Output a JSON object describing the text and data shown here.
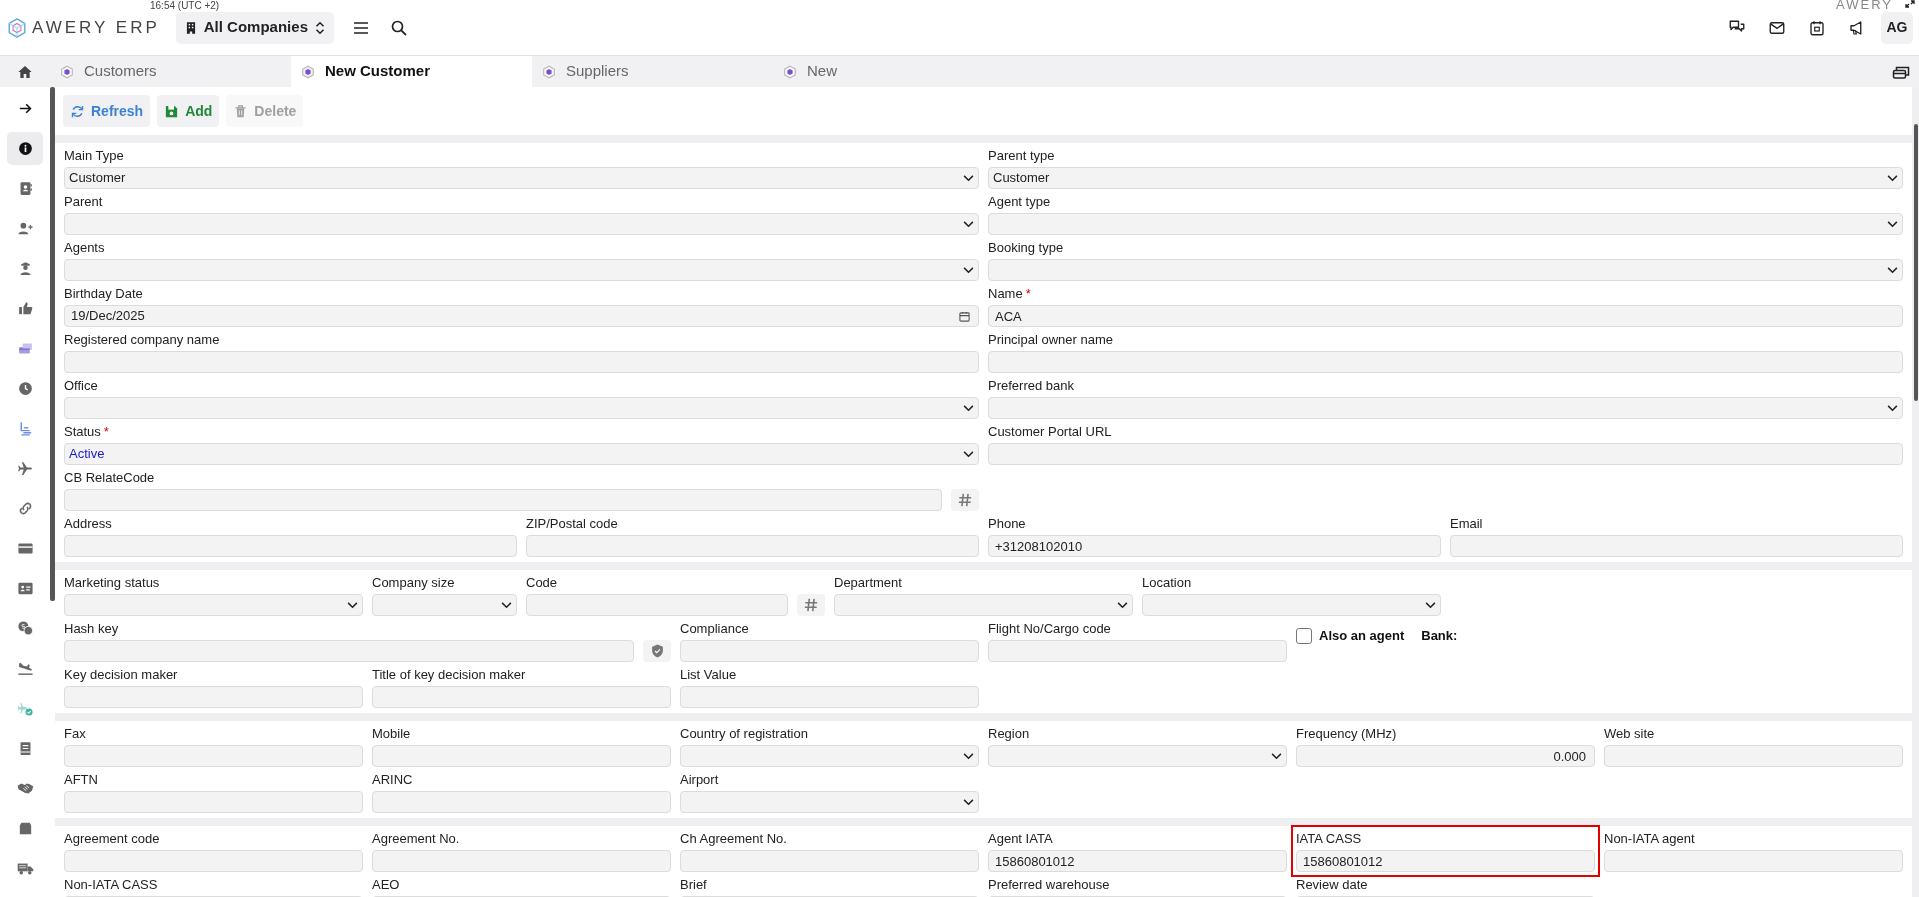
{
  "header": {
    "time": "16:54 (UTC +2)",
    "logo": "AWERY ERP",
    "company": "All Companies",
    "avatar": "AG",
    "corner_logo": "AWERY"
  },
  "tabs": [
    {
      "label": "Customers",
      "selected": false
    },
    {
      "label": "New Customer",
      "selected": true
    },
    {
      "label": "Suppliers",
      "selected": false
    },
    {
      "label": "New",
      "selected": false
    }
  ],
  "sidebar": [
    {
      "kind": "arrow",
      "selected": false
    },
    {
      "kind": "info",
      "selected": true
    },
    {
      "kind": "contact",
      "selected": false
    },
    {
      "kind": "user-plus",
      "selected": false
    },
    {
      "kind": "officer",
      "selected": false
    },
    {
      "kind": "thumb",
      "selected": false
    },
    {
      "kind": "cards",
      "selected": false
    },
    {
      "kind": "clock",
      "selected": false
    },
    {
      "kind": "seat",
      "selected": false
    },
    {
      "kind": "plane",
      "selected": false
    },
    {
      "kind": "link",
      "selected": false
    },
    {
      "kind": "card",
      "selected": false
    },
    {
      "kind": "id",
      "selected": false
    },
    {
      "kind": "chat",
      "selected": false
    },
    {
      "kind": "landing",
      "selected": false
    },
    {
      "kind": "plane-check",
      "selected": false
    },
    {
      "kind": "book",
      "selected": false
    },
    {
      "kind": "handshake",
      "selected": false
    },
    {
      "kind": "box",
      "selected": false
    },
    {
      "kind": "truck",
      "selected": false
    }
  ],
  "toolbar": [
    {
      "kind": "refresh",
      "label": "Refresh",
      "disabled": false
    },
    {
      "kind": "add",
      "label": "Add",
      "disabled": false
    },
    {
      "kind": "delete",
      "label": "Delete",
      "disabled": true
    }
  ],
  "sections": [
    {
      "rows": [
        [
          {
            "label": "Main Type",
            "kind": "select",
            "value": "Customer"
          },
          {
            "label": "Parent type",
            "kind": "select",
            "value": "Customer"
          }
        ],
        [
          {
            "label": "Parent",
            "kind": "select"
          },
          {
            "label": "Agent type",
            "kind": "select"
          }
        ],
        [
          {
            "label": "Agents",
            "kind": "select"
          },
          {
            "label": "Booking type",
            "kind": "select"
          }
        ],
        [
          {
            "label": "Birthday Date",
            "kind": "date",
            "value": "19/Dec/2025"
          },
          {
            "label": "Name",
            "required_mark": "*",
            "kind": "input",
            "value": "ACA"
          }
        ],
        [
          {
            "label": "Registered company name",
            "kind": "input"
          },
          {
            "label": "Principal owner name",
            "kind": "input"
          }
        ],
        [
          {
            "label": "Office",
            "kind": "select"
          },
          {
            "label": "Preferred bank",
            "kind": "select"
          }
        ],
        [
          {
            "label": "Status",
            "required_mark": "*",
            "kind": "select",
            "value": "Active",
            "color": "#1a1acc"
          },
          {
            "label": "Customer Portal URL",
            "kind": "input"
          }
        ],
        [
          {
            "label": "CB RelateCode",
            "kind": "input_hash"
          }
        ],
        [
          {
            "label": "Address",
            "kind": "input"
          },
          {
            "label": "ZIP/Postal code",
            "kind": "input"
          },
          {
            "label": "Phone",
            "kind": "input",
            "value": "+31208102010"
          },
          {
            "label": "Email",
            "kind": "input"
          }
        ]
      ]
    },
    {
      "rows": [
        [
          {
            "label": "Marketing status",
            "kind": "select"
          },
          {
            "label": "Company size",
            "kind": "select"
          },
          {
            "label": "Code",
            "kind": "input_hash"
          },
          {
            "label": "Department",
            "kind": "select"
          },
          {
            "label": "Location",
            "kind": "select"
          }
        ],
        [
          {
            "label": "Hash key",
            "kind": "input_shield"
          },
          {
            "label": "Compliance",
            "kind": "input"
          },
          {
            "label": "Flight No/Cargo code",
            "kind": "input"
          },
          {
            "label": "Also an agent",
            "kind": "checkbox",
            "checked": false,
            "note": "Bank:"
          }
        ],
        [
          {
            "label": "Key decision maker",
            "kind": "input"
          },
          {
            "label": "Title of key decision maker",
            "kind": "input"
          },
          {
            "label": "List Value",
            "kind": "input"
          }
        ]
      ]
    },
    {
      "rows": [
        [
          {
            "label": "Fax",
            "kind": "input"
          },
          {
            "label": "Mobile",
            "kind": "input"
          },
          {
            "label": "Country of registration",
            "kind": "select"
          },
          {
            "label": "Region",
            "kind": "select"
          },
          {
            "label": "Frequency (MHz)",
            "kind": "number",
            "value": "0.000"
          },
          {
            "label": "Web site",
            "kind": "input"
          }
        ],
        [
          {
            "label": "AFTN",
            "kind": "input"
          },
          {
            "label": "ARINC",
            "kind": "input"
          },
          {
            "label": "Airport",
            "kind": "select"
          }
        ]
      ]
    },
    {
      "rows": [
        [
          {
            "label": "Agreement code",
            "kind": "input"
          },
          {
            "label": "Agreement No.",
            "kind": "input"
          },
          {
            "label": "Ch Agreement No.",
            "kind": "input"
          },
          {
            "label": "Agent IATA",
            "kind": "input",
            "value": "15860801012"
          },
          {
            "label": "IATA CASS",
            "kind": "input",
            "value": "15860801012",
            "highlighted": true
          },
          {
            "label": "Non-IATA agent",
            "kind": "input"
          }
        ],
        [
          {
            "label": "Non-IATA CASS",
            "kind": "input"
          },
          {
            "label": "AEO",
            "kind": "input"
          },
          {
            "label": "Brief",
            "kind": "input"
          },
          {
            "label": "Preferred warehouse",
            "kind": "input"
          },
          {
            "label": "Review date",
            "kind": "input"
          }
        ]
      ]
    }
  ]
}
